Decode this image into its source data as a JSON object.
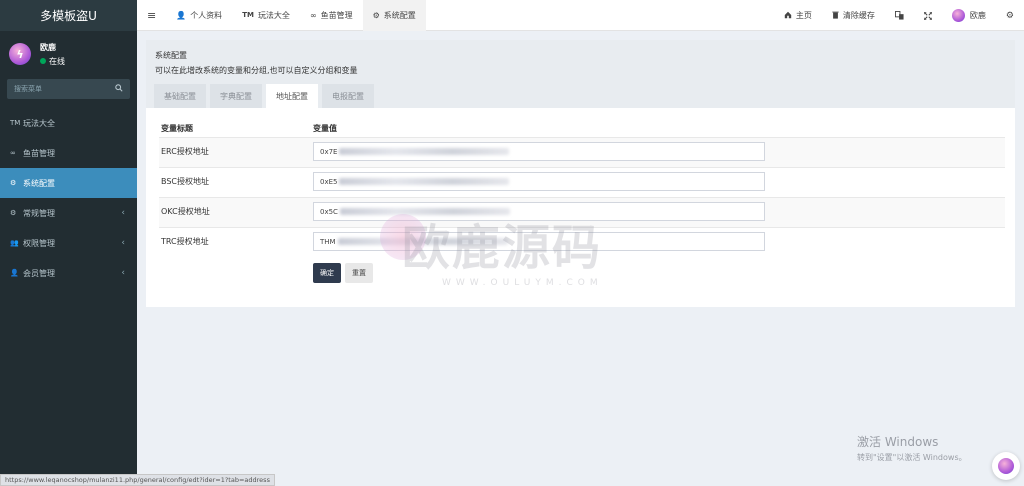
{
  "app": {
    "title": "多模板盗U"
  },
  "user": {
    "name": "欧鹿",
    "status": "在线"
  },
  "sidebar": {
    "search_placeholder": "搜索菜单",
    "items": [
      {
        "icon": "TM",
        "label": "玩法大全"
      },
      {
        "icon": "∞",
        "label": "鱼苗管理"
      },
      {
        "icon": "⚙",
        "label": "系统配置"
      },
      {
        "icon": "⚙",
        "label": "常规管理"
      },
      {
        "icon": "👥",
        "label": "权限管理"
      },
      {
        "icon": "👤",
        "label": "会员管理"
      }
    ]
  },
  "topbar": {
    "menu_icon": "≡",
    "tabs": [
      {
        "icon": "👤",
        "label": "个人资料"
      },
      {
        "icon": "TM",
        "label": "玩法大全"
      },
      {
        "icon": "∞",
        "label": "鱼苗管理"
      },
      {
        "icon": "⚙",
        "label": "系统配置"
      }
    ],
    "home_label": "主页",
    "clear_cache_label": "清除缓存",
    "username": "欧鹿"
  },
  "page": {
    "title": "系统配置",
    "description": "可以在此增改系统的变量和分组,也可以自定义分组和变量",
    "tabs": [
      "基础配置",
      "字典配置",
      "地址配置",
      "电报配置"
    ],
    "table": {
      "headers": [
        "变量标题",
        "变量值"
      ],
      "rows": [
        {
          "label": "ERC授权地址",
          "value_prefix": "0x7E"
        },
        {
          "label": "BSC授权地址",
          "value_prefix": "0xE5"
        },
        {
          "label": "OKC授权地址",
          "value_prefix": "0x5C"
        },
        {
          "label": "TRC授权地址",
          "value_prefix": "THM"
        }
      ]
    },
    "confirm_label": "确定",
    "reset_label": "重置"
  },
  "watermark": {
    "main": "欧鹿源码",
    "sub": "WWW.OULUYM.COM"
  },
  "windows_activation": {
    "line1": "激活 Windows",
    "line2": "转到\"设置\"以激活 Windows。"
  },
  "status_url": "https://www.leqanocshop/mulanzi11.php/general/config/edt?ider=1?tab=address"
}
